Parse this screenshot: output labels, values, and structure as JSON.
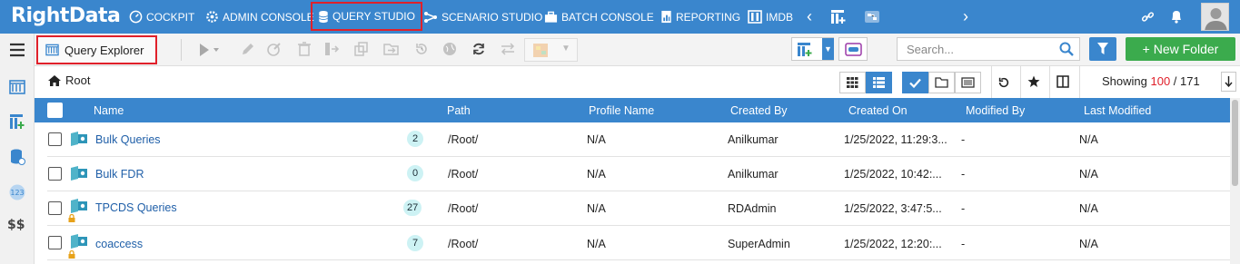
{
  "brand": {
    "logo_text": "RightData"
  },
  "nav": {
    "items": [
      {
        "label": "COCKPIT",
        "icon": "gauge-icon"
      },
      {
        "label": "ADMIN CONSOLE",
        "icon": "gear-icon"
      },
      {
        "label": "QUERY STUDIO",
        "icon": "database-icon",
        "active": true
      },
      {
        "label": "SCENARIO STUDIO",
        "icon": "branch-icon"
      },
      {
        "label": "BATCH CONSOLE",
        "icon": "briefcase-icon"
      },
      {
        "label": "REPORTING",
        "icon": "report-icon"
      },
      {
        "label": "IMDB",
        "icon": "columns-icon"
      }
    ]
  },
  "toolbar": {
    "explorer_label": "Query Explorer",
    "search_placeholder": "Search...",
    "new_folder_label": "+ New Folder"
  },
  "breadcrumb": {
    "root_label": "Root"
  },
  "paging": {
    "prefix": "Showing ",
    "shown": "100",
    "sep": " / ",
    "total": "171"
  },
  "table": {
    "headers": {
      "name": "Name",
      "path": "Path",
      "profile": "Profile Name",
      "created_by": "Created By",
      "created_on": "Created On",
      "modified_by": "Modified By",
      "last_modified": "Last Modified"
    },
    "rows": [
      {
        "name": "Bulk Queries",
        "count": "2",
        "path": "/Root/",
        "profile": "N/A",
        "created_by": "Anilkumar",
        "created_on": "1/25/2022, 11:29:3...",
        "modified_by": "-",
        "last_modified": "N/A",
        "locked": false
      },
      {
        "name": "Bulk FDR",
        "count": "0",
        "path": "/Root/",
        "profile": "N/A",
        "created_by": "Anilkumar",
        "created_on": "1/25/2022, 10:42:...",
        "modified_by": "-",
        "last_modified": "N/A",
        "locked": false
      },
      {
        "name": "TPCDS Queries",
        "count": "27",
        "path": "/Root/",
        "profile": "N/A",
        "created_by": "RDAdmin",
        "created_on": "1/25/2022, 3:47:5...",
        "modified_by": "-",
        "last_modified": "N/A",
        "locked": true
      },
      {
        "name": "coaccess",
        "count": "7",
        "path": "/Root/",
        "profile": "N/A",
        "created_by": "SuperAdmin",
        "created_on": "1/25/2022, 12:20:...",
        "modified_by": "-",
        "last_modified": "N/A",
        "locked": true
      }
    ]
  },
  "colors": {
    "primary": "#3a86cd",
    "highlight": "#e0202a",
    "success": "#3bab4d",
    "badge": "#cdf2f4"
  }
}
